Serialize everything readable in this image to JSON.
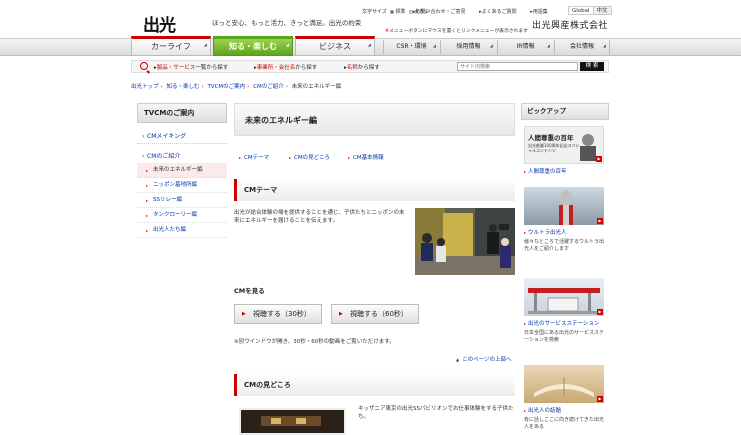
{
  "header": {
    "logo": "出光",
    "tagline": "ほっと安心、もっと活力、きっと満足。出光の約束",
    "font_size_label": "文字サイズ",
    "font_size_options": [
      "標準",
      "大きい"
    ],
    "top_links": [
      "お問い合わせ・ご意見",
      "よくあるご質問",
      "用語集"
    ],
    "lang_global": "Global",
    "lang_chinese": "中文",
    "company": "出光興産株式会社",
    "menu_note": "メニューボタンにマウスを置くとリンクメニューが表示されます"
  },
  "global_nav": {
    "tabs": [
      "カーライフ",
      "知る・楽しむ",
      "ビジネス"
    ],
    "sub_tabs": [
      "CSR・環境",
      "採用情報",
      "IR情報",
      "会社情報"
    ]
  },
  "search": {
    "links": [
      {
        "strong": "製品・サービス",
        "rest": "一覧から探す"
      },
      {
        "strong": "事業所・会社名",
        "rest": "から探す"
      },
      {
        "strong": "名称",
        "rest": "から探す"
      }
    ],
    "placeholder": "サイト内検索",
    "button": "検 索"
  },
  "breadcrumb": {
    "items": [
      "出光トップ",
      "知る・楽しむ",
      "TVCMのご案内",
      "CMのご紹介"
    ],
    "current": "未来のエネルギー編"
  },
  "left_nav": {
    "title": "TVCMのご案内",
    "item1": "CMメイキング",
    "group": "CMのご紹介",
    "subs": [
      "未来のエネルギー編",
      "ニッポン基地所編",
      "SSリレー編",
      "タンクローリー編",
      "出光人たち編"
    ]
  },
  "main": {
    "title": "未来のエネルギー編",
    "anchors": [
      "CMテーマ",
      "CMの見どころ",
      "CM基本情報"
    ],
    "section_theme": "CMテーマ",
    "theme_text": "出光が総合体験の場を提供することを通じ、子供たちとニッポンの未来にエネルギーを届けることを伝えます。",
    "watch_heading": "CMを見る",
    "btn_30": "視聴する（30秒）",
    "btn_60": "視聴する（60秒）",
    "watch_note": "※別ウインドウが開き、30秒・60秒の動画をご覧いただけます。",
    "to_top": "このページの上部へ",
    "section_highlight": "CMの見どころ",
    "highlight_text": "キッザニア東京の出光SSパビリオンでお仕事体験をする子供たち。"
  },
  "pickup": {
    "title": "ピックアップ",
    "items": [
      {
        "img_text": "人間尊重の百年",
        "img_sub": "出光創業100周年記念スペシャルコンテンツ",
        "title": "人間尊重の百年",
        "desc": ""
      },
      {
        "img_text": "ウルトラ出光人",
        "img_sub": "",
        "title": "ウルトラ出光人",
        "desc": "様々なところで活躍するウルトラ出光人をご紹介します"
      },
      {
        "img_text": "",
        "img_sub": "",
        "title": "出光のサービスステーション",
        "desc": "日本全国にある出光のサービスステーションを検索"
      },
      {
        "img_text": "",
        "img_sub": "",
        "title": "出光人の話題",
        "desc": "有に話しここに向き続けてきた出光人をある"
      }
    ]
  }
}
